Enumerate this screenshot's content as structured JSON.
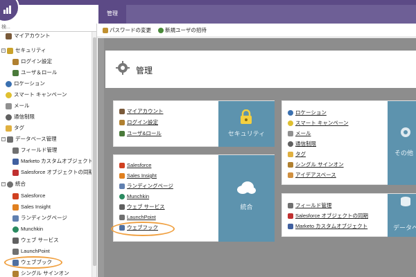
{
  "topbar": {
    "active_tab": "管理"
  },
  "sidebar": {
    "search_placeholder": "検...",
    "items": [
      {
        "label": "マイアカウント",
        "icon": "user-icon",
        "color": "#7a5a3a"
      },
      {
        "label": "セキュリティ",
        "icon": "lock-icon",
        "color": "#caa22a"
      },
      {
        "label": "ログイン設定",
        "icon": "key-icon",
        "color": "#b08030"
      },
      {
        "label": "ユーザ＆ロール",
        "icon": "users-icon",
        "color": "#4a7a3a"
      },
      {
        "label": "ロケーション",
        "icon": "globe-icon",
        "color": "#3a70b0"
      },
      {
        "label": "スマート キャンペーン",
        "icon": "bulb-icon",
        "color": "#e0c030"
      },
      {
        "label": "メール",
        "icon": "mail-icon",
        "color": "#909090"
      },
      {
        "label": "通信制限",
        "icon": "limit-icon",
        "color": "#606060"
      },
      {
        "label": "タグ",
        "icon": "tag-icon",
        "color": "#e0b040"
      },
      {
        "label": "データベース管理",
        "icon": "database-icon",
        "color": "#707070"
      },
      {
        "label": "フィールド管理",
        "icon": "field-icon",
        "color": "#707070"
      },
      {
        "label": "Marketo カスタムオブジェクト",
        "icon": "custom-object-icon",
        "color": "#4060a0"
      },
      {
        "label": "Salesforce オブジェクトの同期",
        "icon": "salesforce-sync-icon",
        "color": "#c03030"
      },
      {
        "label": "統合",
        "icon": "integration-icon",
        "color": "#707070"
      },
      {
        "label": "Salesforce",
        "icon": "salesforce-icon",
        "color": "#d04020"
      },
      {
        "label": "Sales Insight",
        "icon": "sales-insight-icon",
        "color": "#e08020"
      },
      {
        "label": "ランディングページ",
        "icon": "landing-page-icon",
        "color": "#6080b0"
      },
      {
        "label": "Munchkin",
        "icon": "munchkin-icon",
        "color": "#2a8a60"
      },
      {
        "label": "ウェブ サービス",
        "icon": "web-service-icon",
        "color": "#606060"
      },
      {
        "label": "LaunchPoint",
        "icon": "launchpoint-icon",
        "color": "#707070"
      },
      {
        "label": "ウェブブック",
        "icon": "webhook-icon",
        "color": "#5070a0"
      },
      {
        "label": "シングル サインオン",
        "icon": "sso-icon",
        "color": "#b08030"
      }
    ]
  },
  "toolbar": {
    "change_password": "パスワードの変更",
    "invite_user": "新規ユーザの招待"
  },
  "header": {
    "title": "管理"
  },
  "cards": {
    "security": {
      "label": "セキュリティ",
      "links": [
        "マイアカウント",
        "ログイン設定",
        "ユーザ&ロール"
      ]
    },
    "other": {
      "label": "その他",
      "links": [
        "ロケーション",
        "スマート キャンペーン",
        "メール",
        "通信制限",
        "タグ",
        "シングル サインオン",
        "アイデアスペース"
      ]
    },
    "integration": {
      "label": "統合",
      "links": [
        "Salesforce",
        "Sales Insight",
        "ランディングページ",
        "Munchkin",
        "ウェブ サービス",
        "LaunchPoint",
        "ウェブフック"
      ]
    },
    "database": {
      "label": "データベ",
      "links": [
        "フィールド管理",
        "Salesforce オブジェクトの同期",
        "Marketo カスタムオブジェクト"
      ]
    }
  }
}
